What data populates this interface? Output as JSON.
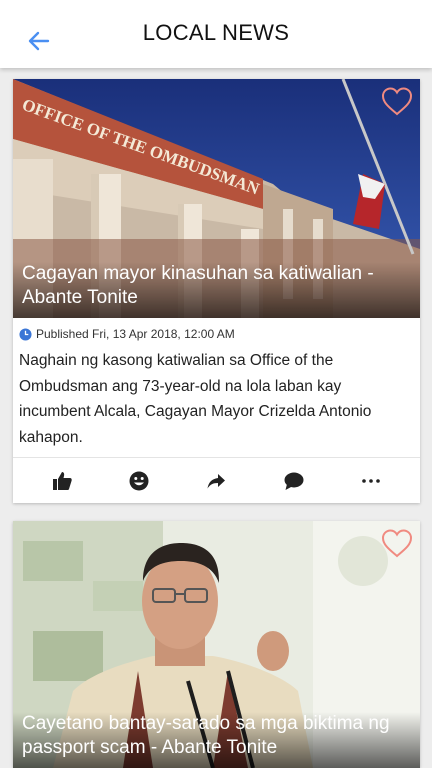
{
  "appbar": {
    "title": "LOCAL NEWS",
    "back_icon": "arrow-left-icon",
    "accent": "#4a8ff2"
  },
  "articles": [
    {
      "headline": "Cagayan mayor kinasuhan sa katiwalian - Abante Tonite",
      "published": "Published Fri, 13 Apr 2018, 12:00 AM",
      "summary": "Naghain ng kasong katiwalian sa Office of the Ombudsman ang 73-year-old na lola laban kay incumbent Alcala, Cagayan Mayor Crizelda Antonio kahapon.",
      "image_sign": "OFFICE OF THE OMBUDSMAN",
      "actions": [
        "thumbs-up-icon",
        "smiley-icon",
        "share-icon",
        "comment-icon",
        "more-icon"
      ]
    },
    {
      "headline": "Cayetano bantay-sarado sa mga biktima ng passport scam - Abante Tonite"
    }
  ],
  "colors": {
    "heart": "#f08a80",
    "icon": "#222222",
    "clock": "#3b76d6"
  }
}
